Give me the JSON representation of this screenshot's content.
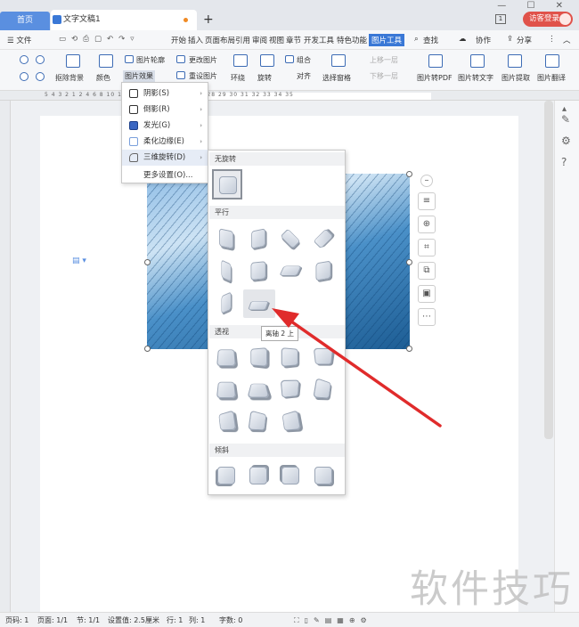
{
  "titlebar": {
    "home_tab": "首页",
    "doc_tab": "文字文稿1",
    "new_tab": "+",
    "window_controls": "— ☐ ✕",
    "page_count": "1",
    "visitor_login": "访客登录"
  },
  "menubar": {
    "file_menu": "☰ 文件",
    "items": [
      "开始",
      "插入",
      "页面布局",
      "引用",
      "审阅",
      "视图",
      "章节",
      "开发工具",
      "特色功能"
    ],
    "active": "图片工具",
    "search": "查找",
    "collab": "协作",
    "share": "分享"
  },
  "ribbon": {
    "remove_bg": "抠除背景",
    "color": "颜色",
    "outline": "图片轮廓",
    "effect": "图片效果",
    "change_picture": "更改图片",
    "reset_picture": "重设图片",
    "wrap": "环绕",
    "rotate": "旋转",
    "group": "组合",
    "align": "对齐",
    "bring_forward": "上移一层",
    "send_backward": "下移一层",
    "selection_pane": "选择窗格",
    "to_pdf": "图片转PDF",
    "to_text": "图片转文字",
    "extract": "图片提取",
    "translate": "图片翻译"
  },
  "ruler_text": "5 4 3 2 1      2 4 6 8 10 12 14 16 18 20 22 24      27 28 29 30 31 32 33 34 35",
  "effect_menu": {
    "items": [
      {
        "label": "阴影(S)"
      },
      {
        "label": "倒影(R)"
      },
      {
        "label": "发光(G)"
      },
      {
        "label": "柔化边缘(E)"
      },
      {
        "label": "三维旋转(D)"
      },
      {
        "label": "更多设置(O)..."
      }
    ]
  },
  "rotation_panel": {
    "no_rotation": "无旋转",
    "parallel": "平行",
    "perspective": "透视",
    "oblique": "倾斜",
    "tooltip": "离轴 2 上"
  },
  "statusbar": {
    "page_num": "页码: 1",
    "pages": "页面: 1/1",
    "section": "节: 1/1",
    "setting": "设置值: 2.5厘米",
    "row": "行: 1",
    "col": "列: 1",
    "words": "字数: 0"
  },
  "watermark": "软件技巧",
  "colors": {
    "accent": "#3a78d6",
    "visitor": "#e0524a",
    "arrow": "#e02b2b"
  }
}
